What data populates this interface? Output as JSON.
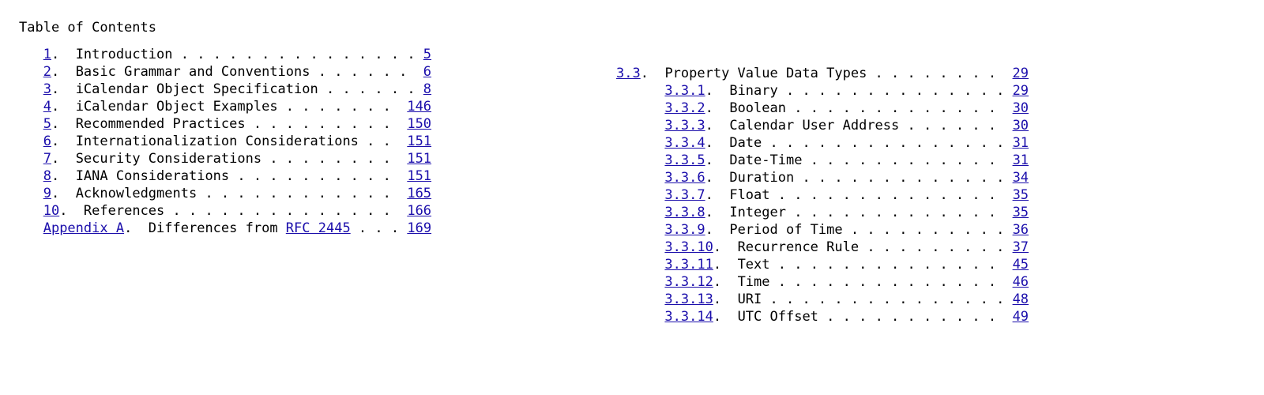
{
  "heading": "Table of Contents",
  "left_line_width": 51,
  "right_line_width": 51,
  "left": [
    {
      "indent": 3,
      "num": "1",
      "num_link": true,
      "title": "Introduction",
      "page": "5"
    },
    {
      "indent": 3,
      "num": "2",
      "num_link": true,
      "title": "Basic Grammar and Conventions",
      "page": "6"
    },
    {
      "indent": 3,
      "num": "3",
      "num_link": true,
      "title": "iCalendar Object Specification",
      "page": "8"
    },
    {
      "indent": 3,
      "num": "4",
      "num_link": true,
      "title": "iCalendar Object Examples",
      "page": "146"
    },
    {
      "indent": 3,
      "num": "5",
      "num_link": true,
      "title": "Recommended Practices",
      "page": "150"
    },
    {
      "indent": 3,
      "num": "6",
      "num_link": true,
      "title": "Internationalization Considerations",
      "page": "151"
    },
    {
      "indent": 3,
      "num": "7",
      "num_link": true,
      "title": "Security Considerations",
      "page": "151"
    },
    {
      "indent": 3,
      "num": "8",
      "num_link": true,
      "title": "IANA Considerations",
      "page": "151"
    },
    {
      "indent": 3,
      "num": "9",
      "num_link": true,
      "title": "Acknowledgments",
      "page": "165"
    },
    {
      "indent": 3,
      "num": "10",
      "num_link": true,
      "title": "References",
      "page": "166"
    },
    {
      "indent": 3,
      "num": "Appendix A",
      "num_link": true,
      "title": "Differences from ",
      "rfc": "RFC 2445",
      "page": "169"
    }
  ],
  "right_header": {
    "indent": 0,
    "num": "3.3",
    "num_link": true,
    "title": "Property Value Data Types",
    "page": "29"
  },
  "right": [
    {
      "indent": 6,
      "num": "3.3.1",
      "num_link": true,
      "title": "Binary",
      "page": "29"
    },
    {
      "indent": 6,
      "num": "3.3.2",
      "num_link": true,
      "title": "Boolean",
      "page": "30"
    },
    {
      "indent": 6,
      "num": "3.3.3",
      "num_link": true,
      "title": "Calendar User Address",
      "page": "30"
    },
    {
      "indent": 6,
      "num": "3.3.4",
      "num_link": true,
      "title": "Date",
      "page": "31"
    },
    {
      "indent": 6,
      "num": "3.3.5",
      "num_link": true,
      "title": "Date-Time",
      "page": "31"
    },
    {
      "indent": 6,
      "num": "3.3.6",
      "num_link": true,
      "title": "Duration",
      "page": "34"
    },
    {
      "indent": 6,
      "num": "3.3.7",
      "num_link": true,
      "title": "Float",
      "page": "35"
    },
    {
      "indent": 6,
      "num": "3.3.8",
      "num_link": true,
      "title": "Integer",
      "page": "35"
    },
    {
      "indent": 6,
      "num": "3.3.9",
      "num_link": true,
      "title": "Period of Time",
      "page": "36"
    },
    {
      "indent": 6,
      "num": "3.3.10",
      "num_link": true,
      "title": "Recurrence Rule",
      "page": "37"
    },
    {
      "indent": 6,
      "num": "3.3.11",
      "num_link": true,
      "title": "Text",
      "page": "45"
    },
    {
      "indent": 6,
      "num": "3.3.12",
      "num_link": true,
      "title": "Time",
      "page": "46"
    },
    {
      "indent": 6,
      "num": "3.3.13",
      "num_link": true,
      "title": "URI",
      "page": "48"
    },
    {
      "indent": 6,
      "num": "3.3.14",
      "num_link": true,
      "title": "UTC Offset",
      "page": "49"
    }
  ]
}
